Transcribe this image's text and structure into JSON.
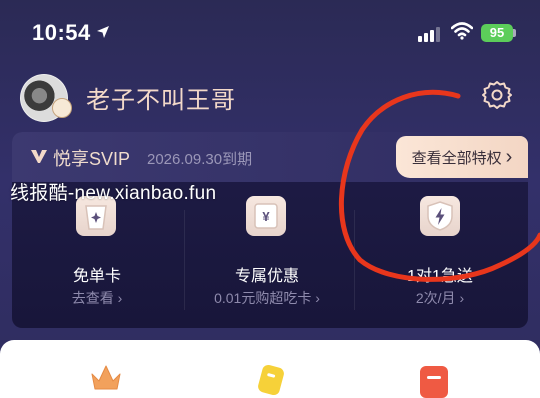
{
  "status_bar": {
    "time": "10:54",
    "battery": "95"
  },
  "profile": {
    "username": "老子不叫王哥"
  },
  "vip": {
    "title": "悦享SVIP",
    "expire": "2026.09.30到期",
    "all_privileges": "查看全部特权",
    "chevron": "›",
    "benefits": [
      {
        "title": "免单卡",
        "sub": "去查看",
        "icon": "cup-icon"
      },
      {
        "title": "专属优惠",
        "sub": "0.01元购超吃卡",
        "icon": "coupon-icon"
      },
      {
        "title": "1对1急送",
        "sub": "2次/月",
        "icon": "lightning-shield-icon"
      }
    ]
  },
  "watermark": "线报酷-new.xianbao.fun",
  "colors": {
    "annotation": "#e8361c",
    "accent": "#f3d9c9",
    "battery": "#5ccd5a"
  }
}
